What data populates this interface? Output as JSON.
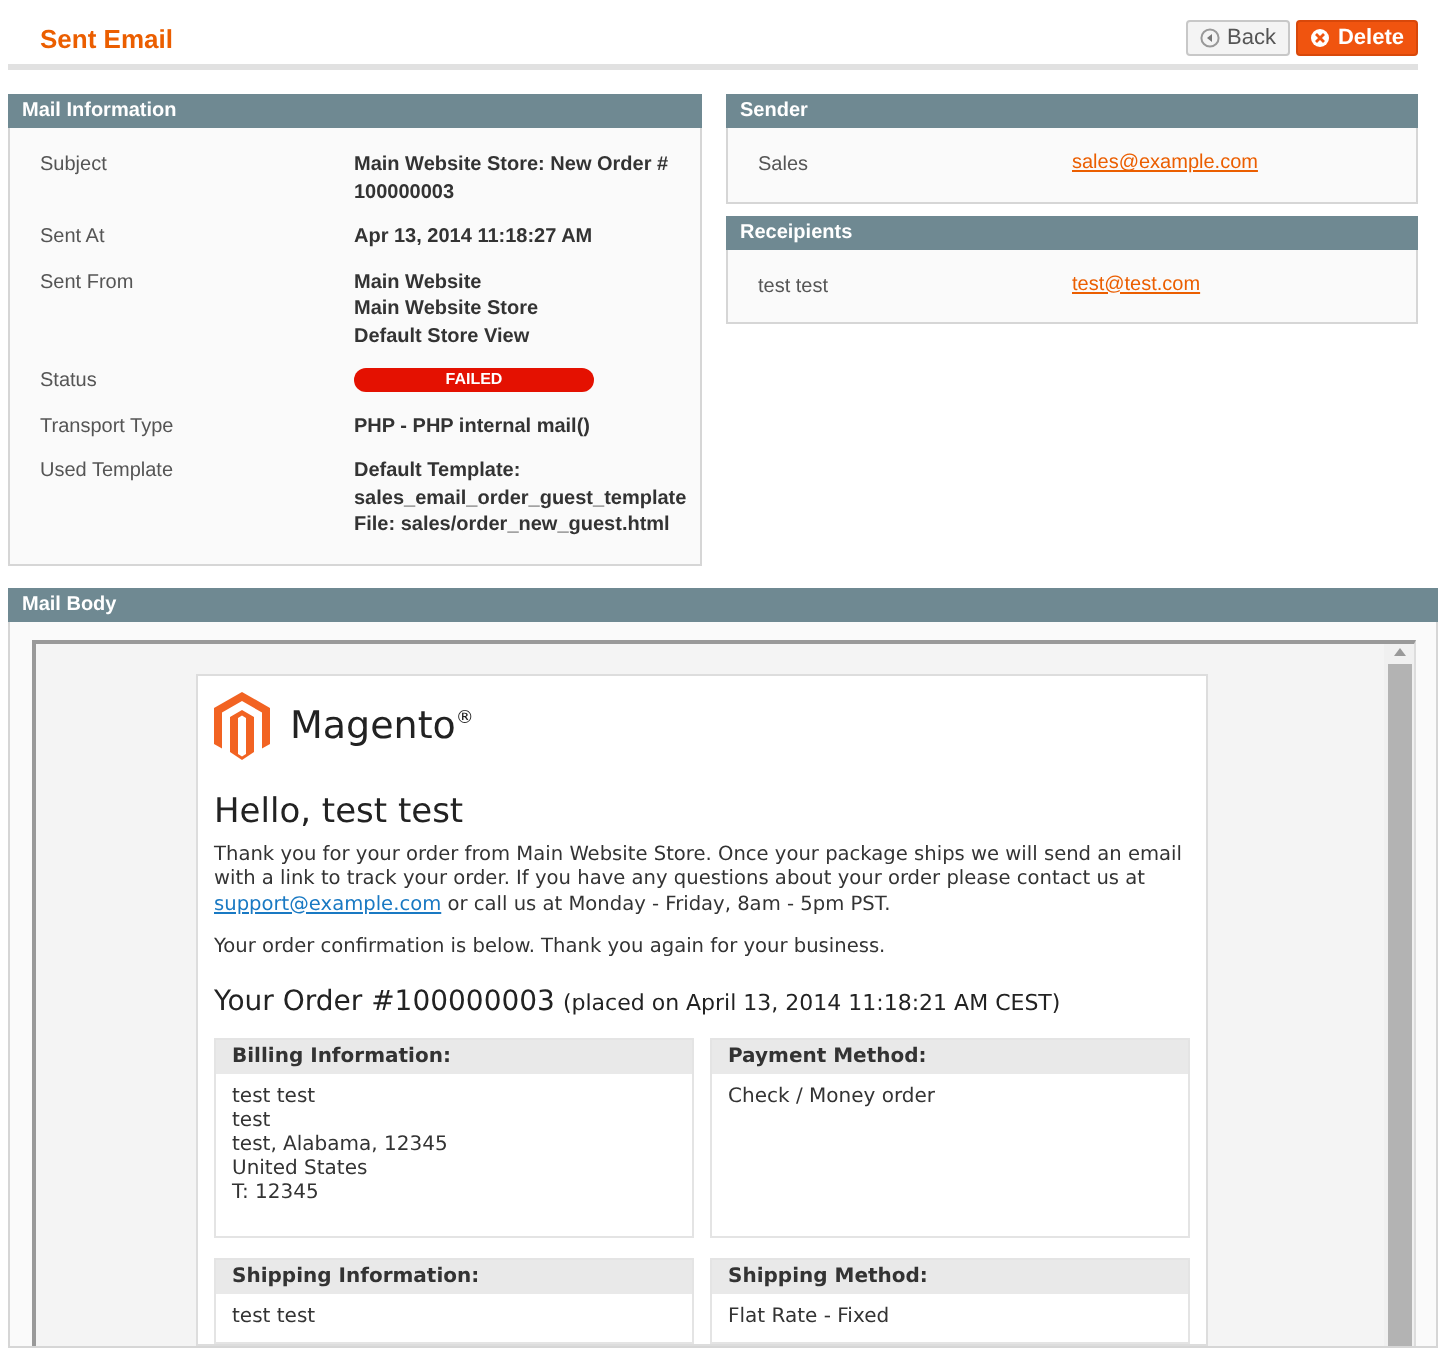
{
  "page": {
    "title": "Sent Email"
  },
  "actions": [
    {
      "label": "Back",
      "kind": "back"
    },
    {
      "label": "Delete",
      "kind": "delete"
    }
  ],
  "mail_information": {
    "title": "Mail Information",
    "rows": [
      {
        "label": "Subject",
        "kind": "text",
        "lines": [
          "Main Website Store: New Order # 100000003"
        ]
      },
      {
        "label": "Sent At",
        "kind": "text",
        "lines": [
          "Apr 13, 2014 11:18:27 AM"
        ]
      },
      {
        "label": "Sent From",
        "kind": "text",
        "lines": [
          "Main Website",
          "Main Website Store",
          "Default Store View"
        ]
      },
      {
        "label": "Status",
        "kind": "status",
        "lines": [
          "FAILED"
        ]
      },
      {
        "label": "Transport Type",
        "kind": "text",
        "lines": [
          "PHP - PHP internal mail()"
        ]
      },
      {
        "label": "Used Template",
        "kind": "text",
        "lines": [
          "Default Template:",
          "sales_email_order_guest_template",
          "File: sales/order_new_guest.html"
        ]
      }
    ]
  },
  "sender": {
    "title": "Sender",
    "rows": [
      {
        "name": "Sales",
        "email": "sales@example.com"
      }
    ]
  },
  "recipients": {
    "title": "Receipients",
    "rows": [
      {
        "name": "test test",
        "email": "test@test.com"
      }
    ]
  },
  "mail_body": {
    "title": "Mail Body",
    "logo": "Magento$^{®}$",
    "greeting": "Hello, test test",
    "intro": "Thank you for your order from Main Website Store. Once your package ships we will send an email with a link to track your order. If you have any questions about your order please contact us at",
    "support_link": "support@example.com",
    "intro_end": "or call us at Monday - Friday, 8am - 5pm PST.",
    "confirmation": "Your order confirmation is below. Thank you again for your business.",
    "order_title": "Your Order #100000003",
    "order_placed": "(placed on April 13, 2014 11:18:21 AM CEST)",
    "blocks": [
      {
        "title": "Billing Information:",
        "lines": [
          "test test",
          "test",
          "test, Alabama, 12345",
          "United States",
          "T: 12345"
        ]
      },
      {
        "title": "Payment Method:",
        "lines": [
          "Check / Money order"
        ]
      },
      {
        "title": "Shipping Information:",
        "lines": [
          "test test"
        ]
      },
      {
        "title": "Shipping Method:",
        "lines": [
          "Flat Rate - Fixed"
        ]
      }
    ]
  }
}
